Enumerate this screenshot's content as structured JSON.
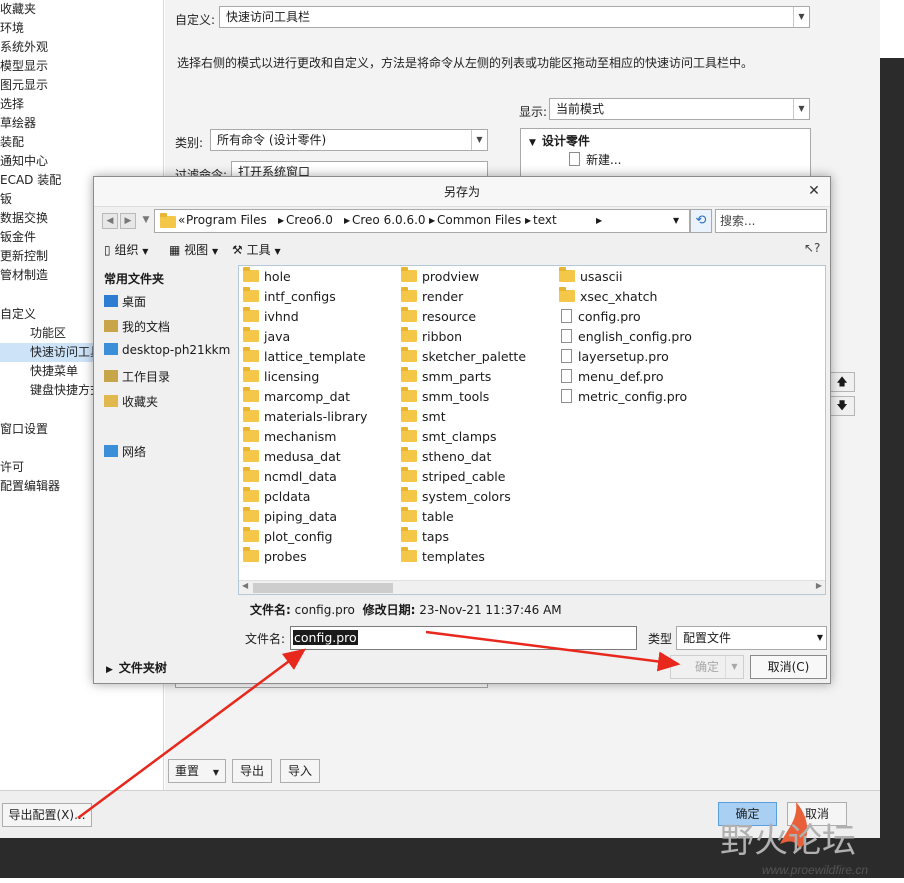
{
  "colors": {
    "accent": "#cde3f7",
    "arrow_red": "#e8281c",
    "ok_blue": "#a9cff3"
  },
  "options_nav": {
    "items": [
      "收藏夹",
      "环境",
      "系统外观",
      "模型显示",
      "图元显示",
      "选择",
      "草绘器",
      "装配",
      "通知中心",
      "ECAD 装配",
      "钣",
      "数据交换",
      "钣金件",
      "更新控制",
      "管材制造"
    ],
    "customize": "自定义",
    "sub_items": [
      "功能区",
      "快速访问工具栏",
      "快捷菜单",
      "键盘快捷方式"
    ],
    "items_after": [
      "窗口设置",
      "许可",
      "配置编辑器"
    ]
  },
  "customize_panel": {
    "label": "自定义:",
    "value": "快速访问工具栏",
    "description": "选择右侧的模式以进行更改和自定义，方法是将命令从左侧的列表或功能区拖动至相应的快速访问工具栏中。",
    "show_label": "显示:",
    "show_value": "当前模式",
    "category_label": "类别:",
    "category_value": "所有命令 (设计零件)",
    "filter_label": "过滤命令:",
    "filter_value": "打开系统窗口",
    "tree_root": "设计零件",
    "tree_child": "新建..."
  },
  "bottom_buttons": {
    "reset": "重置",
    "export": "导出",
    "import": "导入",
    "export_config": "导出配置(X)...",
    "ok": "确定",
    "cancel": "取消"
  },
  "save_as": {
    "title": "另存为",
    "breadcrumb": [
      "Program Files",
      "Creo6.0",
      "Creo 6.0.6.0",
      "Common Files",
      "text"
    ],
    "search_placeholder": "搜索...",
    "toolbar": {
      "organize": "组织",
      "view": "视图",
      "tools": "工具"
    },
    "nav_heading": "常用文件夹",
    "nav_links": [
      "桌面",
      "我的文档",
      "desktop-ph21kkm",
      "工作目录",
      "收藏夹"
    ],
    "network": "网络",
    "folder_tree": "文件夹树",
    "columns": [
      [
        {
          "n": "hole",
          "t": "folder"
        },
        {
          "n": "intf_configs",
          "t": "folder"
        },
        {
          "n": "ivhnd",
          "t": "folder"
        },
        {
          "n": "java",
          "t": "folder"
        },
        {
          "n": "lattice_template",
          "t": "folder"
        },
        {
          "n": "licensing",
          "t": "folder"
        },
        {
          "n": "marcomp_dat",
          "t": "folder"
        },
        {
          "n": "materials-library",
          "t": "folder"
        },
        {
          "n": "mechanism",
          "t": "folder"
        },
        {
          "n": "medusa_dat",
          "t": "folder"
        },
        {
          "n": "ncmdl_data",
          "t": "folder"
        },
        {
          "n": "pcldata",
          "t": "folder"
        },
        {
          "n": "piping_data",
          "t": "folder"
        },
        {
          "n": "plot_config",
          "t": "folder"
        },
        {
          "n": "probes",
          "t": "folder"
        }
      ],
      [
        {
          "n": "prodview",
          "t": "folder"
        },
        {
          "n": "render",
          "t": "folder"
        },
        {
          "n": "resource",
          "t": "folder"
        },
        {
          "n": "ribbon",
          "t": "folder"
        },
        {
          "n": "sketcher_palette",
          "t": "folder"
        },
        {
          "n": "smm_parts",
          "t": "folder"
        },
        {
          "n": "smm_tools",
          "t": "folder"
        },
        {
          "n": "smt",
          "t": "folder"
        },
        {
          "n": "smt_clamps",
          "t": "folder"
        },
        {
          "n": "stheno_dat",
          "t": "folder"
        },
        {
          "n": "striped_cable",
          "t": "folder"
        },
        {
          "n": "system_colors",
          "t": "folder"
        },
        {
          "n": "table",
          "t": "folder"
        },
        {
          "n": "taps",
          "t": "folder"
        },
        {
          "n": "templates",
          "t": "folder"
        }
      ],
      [
        {
          "n": "usascii",
          "t": "folder"
        },
        {
          "n": "xsec_xhatch",
          "t": "folder"
        },
        {
          "n": "config.pro",
          "t": "file"
        },
        {
          "n": "english_config.pro",
          "t": "file"
        },
        {
          "n": "layersetup.pro",
          "t": "file"
        },
        {
          "n": "menu_def.pro",
          "t": "file"
        },
        {
          "n": "metric_config.pro",
          "t": "file"
        }
      ]
    ],
    "info_name_label": "文件名:",
    "info_name": "config.pro",
    "info_date_label": "修改日期:",
    "info_date": "23-Nov-21 11:37:46 AM",
    "filename_label": "文件名:",
    "filename_value": "config.pro",
    "type_label": "类型",
    "type_value": "配置文件",
    "ok": "确定",
    "cancel": "取消(C)"
  },
  "watermark": {
    "brand": "野火论坛",
    "url": "www.proewildfire.cn"
  }
}
